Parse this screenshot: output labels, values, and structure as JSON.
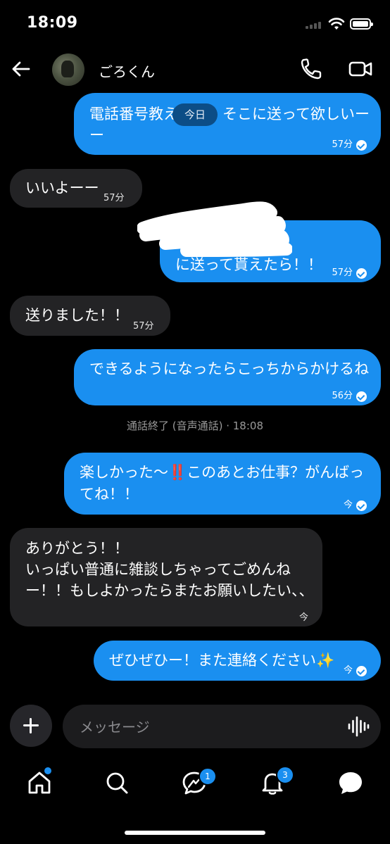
{
  "status_bar": {
    "time": "18:09"
  },
  "header": {
    "contact_name": "ごろくん"
  },
  "date_separator": "今日",
  "messages": [
    {
      "direction": "out",
      "lines": [
        "電話番号教え　　　そこに送って欲しいー",
        "ー"
      ],
      "time": "57分"
    },
    {
      "direction": "in",
      "lines": [
        "いいよーー"
      ],
      "time": "57分"
    },
    {
      "direction": "out",
      "lines": [
        "に送って貰えたら！！"
      ],
      "time": "57分"
    },
    {
      "direction": "in",
      "lines": [
        "送りました！！"
      ],
      "time": "57分"
    },
    {
      "direction": "out",
      "lines": [
        "できるようになったらこっちからかけるね"
      ],
      "time": "56分"
    },
    {
      "direction": "out",
      "lines": [
        "楽しかった〜‼️このあとお仕事？がんばっ",
        "てね！！"
      ],
      "time": "今"
    },
    {
      "direction": "in",
      "lines": [
        "ありがとう！！",
        "いっぱい普通に雑談しちゃってごめんね",
        "ー！！もしよかったらまたお願いしたい、、"
      ],
      "time": "今"
    },
    {
      "direction": "out",
      "lines": [
        "ぜひぜひー！また連絡ください✨"
      ],
      "time": "今"
    }
  ],
  "call_ended": "通話終了 (音声通話) · 18:08",
  "composer": {
    "placeholder": "メッセージ"
  },
  "tab_bar": {
    "messages_badge": "1",
    "notifications_badge": "3"
  },
  "colors": {
    "accent": "#1a8ff0",
    "incoming_bubble": "#232325",
    "background": "#000000"
  }
}
